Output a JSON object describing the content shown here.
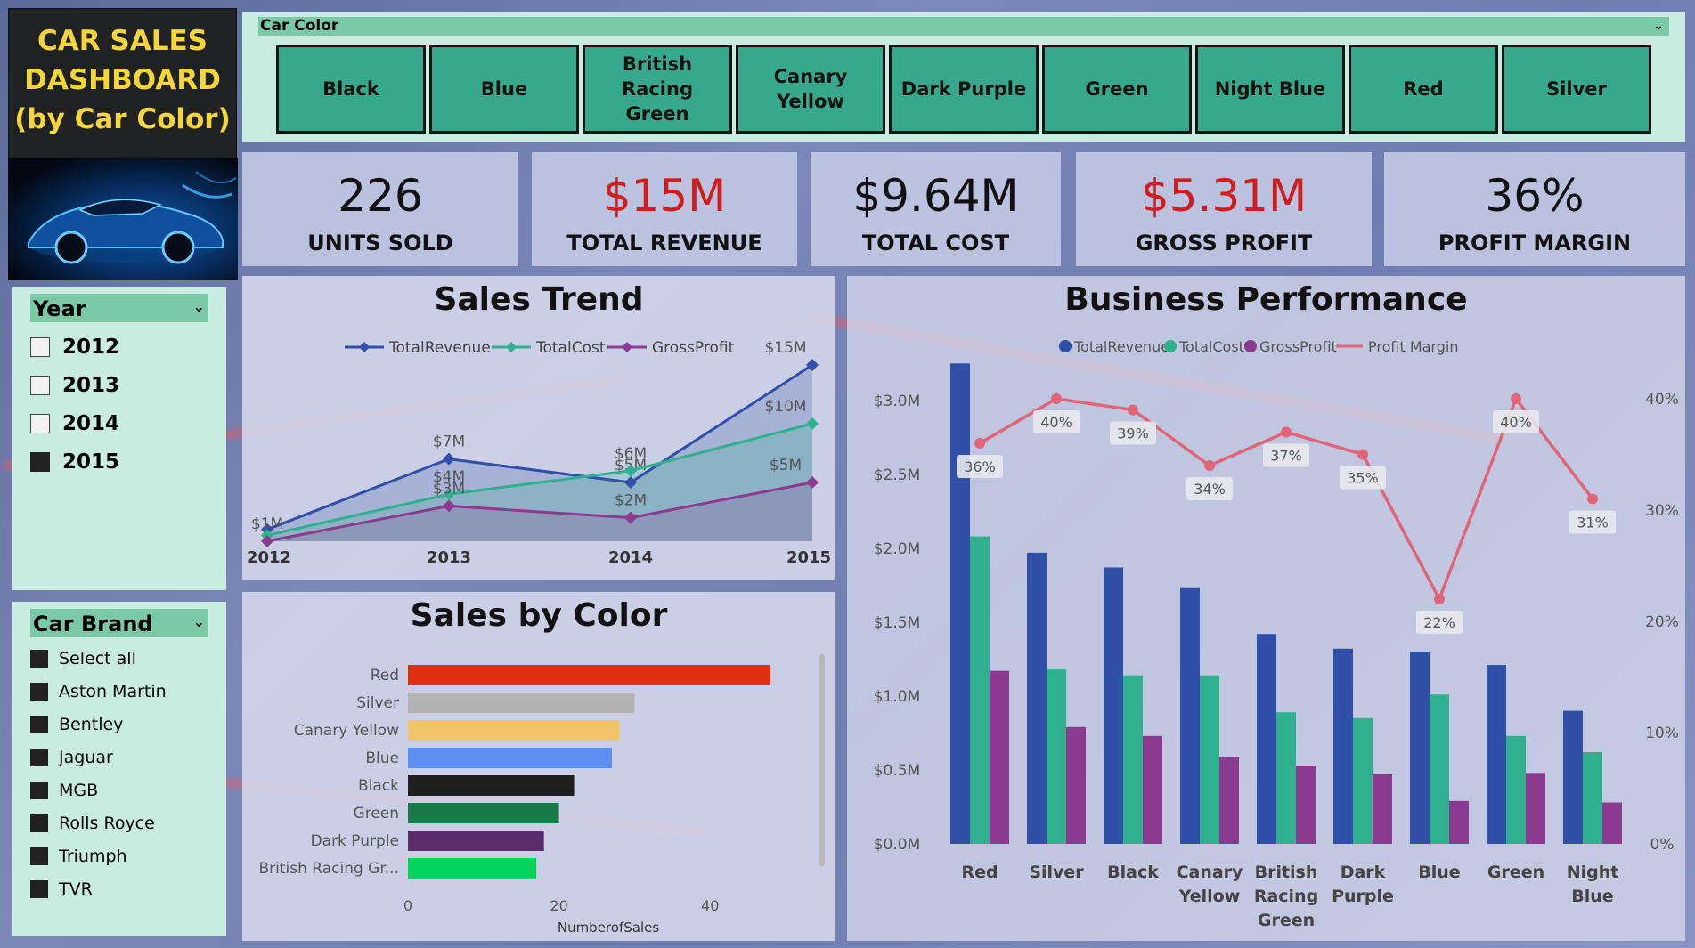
{
  "header": {
    "title_lines": [
      "CAR SALES",
      "DASHBOARD",
      "(by Car Color)"
    ]
  },
  "color_slicer": {
    "label": "Car Color",
    "options": [
      "Black",
      "Blue",
      "British Racing Green",
      "Canary Yellow",
      "Dark Purple",
      "Green",
      "Night Blue",
      "Red",
      "Silver"
    ]
  },
  "kpis": [
    {
      "value": "226",
      "label": "UNITS SOLD",
      "value_color": "#111111"
    },
    {
      "value": "$15M",
      "label": "TOTAL REVENUE",
      "value_color": "#d01c1c"
    },
    {
      "value": "$9.64M",
      "label": "TOTAL COST",
      "value_color": "#111111"
    },
    {
      "value": "$5.31M",
      "label": "GROSS PROFIT",
      "value_color": "#d01c1c"
    },
    {
      "value": "36%",
      "label": "PROFIT MARGIN",
      "value_color": "#111111"
    }
  ],
  "year_slicer": {
    "label": "Year",
    "options": [
      {
        "label": "2012",
        "checked": false
      },
      {
        "label": "2013",
        "checked": false
      },
      {
        "label": "2014",
        "checked": false
      },
      {
        "label": "2015",
        "checked": true
      }
    ]
  },
  "brand_slicer": {
    "label": "Car Brand",
    "options": [
      "Select all",
      "Aston Martin",
      "Bentley",
      "Jaguar",
      "MGB",
      "Rolls Royce",
      "Triumph",
      "TVR"
    ]
  },
  "chart_data": [
    {
      "id": "sales-trend",
      "type": "line",
      "title": "Sales Trend",
      "x": [
        "2012",
        "2013",
        "2014",
        "2015"
      ],
      "series": [
        {
          "name": "TotalRevenue",
          "color": "#2f4fa8",
          "values": [
            1.0,
            7.0,
            5.0,
            15.0
          ],
          "labels": [
            "",
            "$7M",
            "$5M",
            "$15M"
          ]
        },
        {
          "name": "TotalCost",
          "color": "#2fb08e",
          "values": [
            0.5,
            4.0,
            6.0,
            10.0
          ],
          "labels": [
            "",
            "$4M",
            "$6M",
            "$10M"
          ]
        },
        {
          "name": "GrossProfit",
          "color": "#8b3a8f",
          "values": [
            0.0,
            3.0,
            2.0,
            5.0
          ],
          "labels": [
            "$1M",
            "$3M",
            "$2M",
            "$5M"
          ]
        }
      ]
    },
    {
      "id": "sales-by-color",
      "type": "bar",
      "orientation": "horizontal",
      "title": "Sales by Color",
      "xlabel": "NumberofSales",
      "xlim": [
        0,
        50
      ],
      "xticks": [
        "0",
        "20",
        "40"
      ],
      "categories": [
        "Red",
        "Silver",
        "Canary Yellow",
        "Blue",
        "Black",
        "Green",
        "Dark Purple",
        "British Racing Gr..."
      ],
      "values": [
        48,
        30,
        28,
        27,
        22,
        20,
        18,
        17
      ],
      "colors": [
        "#e0300f",
        "#b3b3b3",
        "#f2c46a",
        "#5b8ff0",
        "#1f1f1f",
        "#1c7a4a",
        "#5c2b6b",
        "#00d45a"
      ]
    },
    {
      "id": "business-performance",
      "type": "bar",
      "title": "Business Performance",
      "categories": [
        "Red",
        "Silver",
        "Black",
        "Canary Yellow",
        "British Racing Green",
        "Dark Purple",
        "Blue",
        "Green",
        "Night Blue"
      ],
      "series": [
        {
          "name": "TotalRevenue",
          "color": "#2f4fa8",
          "values": [
            3.25,
            1.97,
            1.87,
            1.73,
            1.42,
            1.32,
            1.3,
            1.21,
            0.9
          ]
        },
        {
          "name": "TotalCost",
          "color": "#2fb08e",
          "values": [
            2.08,
            1.18,
            1.14,
            1.14,
            0.89,
            0.85,
            1.01,
            0.73,
            0.62
          ]
        },
        {
          "name": "GrossProfit",
          "color": "#8b3a8f",
          "values": [
            1.17,
            0.79,
            0.73,
            0.59,
            0.53,
            0.47,
            0.29,
            0.48,
            0.28
          ]
        }
      ],
      "line_series": {
        "name": "Profit Margin",
        "color": "#e06578",
        "values": [
          36,
          40,
          39,
          34,
          37,
          35,
          22,
          40,
          31
        ],
        "labels": [
          "36%",
          "40%",
          "39%",
          "34%",
          "37%",
          "35%",
          "22%",
          "40%",
          "31%"
        ]
      },
      "ylim": [
        0,
        3.3
      ],
      "yticks": [
        "$0.0M",
        "$0.5M",
        "$1.0M",
        "$1.5M",
        "$2.0M",
        "$2.5M",
        "$3.0M"
      ],
      "y2lim": [
        0,
        40
      ],
      "y2ticks": [
        "0%",
        "10%",
        "20%",
        "30%",
        "40%"
      ]
    }
  ]
}
